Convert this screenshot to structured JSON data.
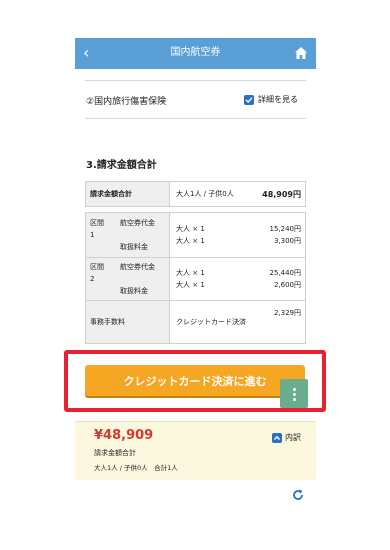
{
  "header": {
    "title": "国内航空券",
    "back_icon": "chevron-left-icon",
    "home_icon": "home-icon",
    "bar_color": "#5a9fd6"
  },
  "insurance": {
    "label": "②国内旅行傷害保険",
    "detail_toggle": "詳細を見る",
    "checked": true
  },
  "billing": {
    "title": "3.請求金額合計",
    "total_row": {
      "label": "請求金額合計",
      "pax": "大人1人 / 子供0人",
      "amount": "48,909円"
    },
    "rows": [
      {
        "section": "区間1",
        "items": [
          {
            "name": "航空券代金",
            "qty": "大人 × 1",
            "amount": "15,240円"
          },
          {
            "name": "取扱料金",
            "qty": "大人 × 1",
            "amount": "3,300円"
          }
        ]
      },
      {
        "section": "区間2",
        "items": [
          {
            "name": "航空券代金",
            "qty": "大人 × 1",
            "amount": "25,440円"
          },
          {
            "name": "取扱料金",
            "qty": "大人 × 1",
            "amount": "2,600円"
          }
        ]
      }
    ],
    "fee": {
      "label": "事務手数料",
      "desc": "クレジットカード決済",
      "amount": "2,329円"
    }
  },
  "cta": {
    "label": "クレジットカード決済に進む",
    "color": "#f5a623"
  },
  "summary": {
    "price": "¥48,909",
    "label": "請求金額合計",
    "people": "大人1人 / 子供0人　合計1人",
    "breakdown": "内訳"
  },
  "accent_colors": {
    "price_red": "#d43a2b",
    "highlight_red": "#e8202f",
    "checkbox_blue": "#2a6fc4"
  }
}
